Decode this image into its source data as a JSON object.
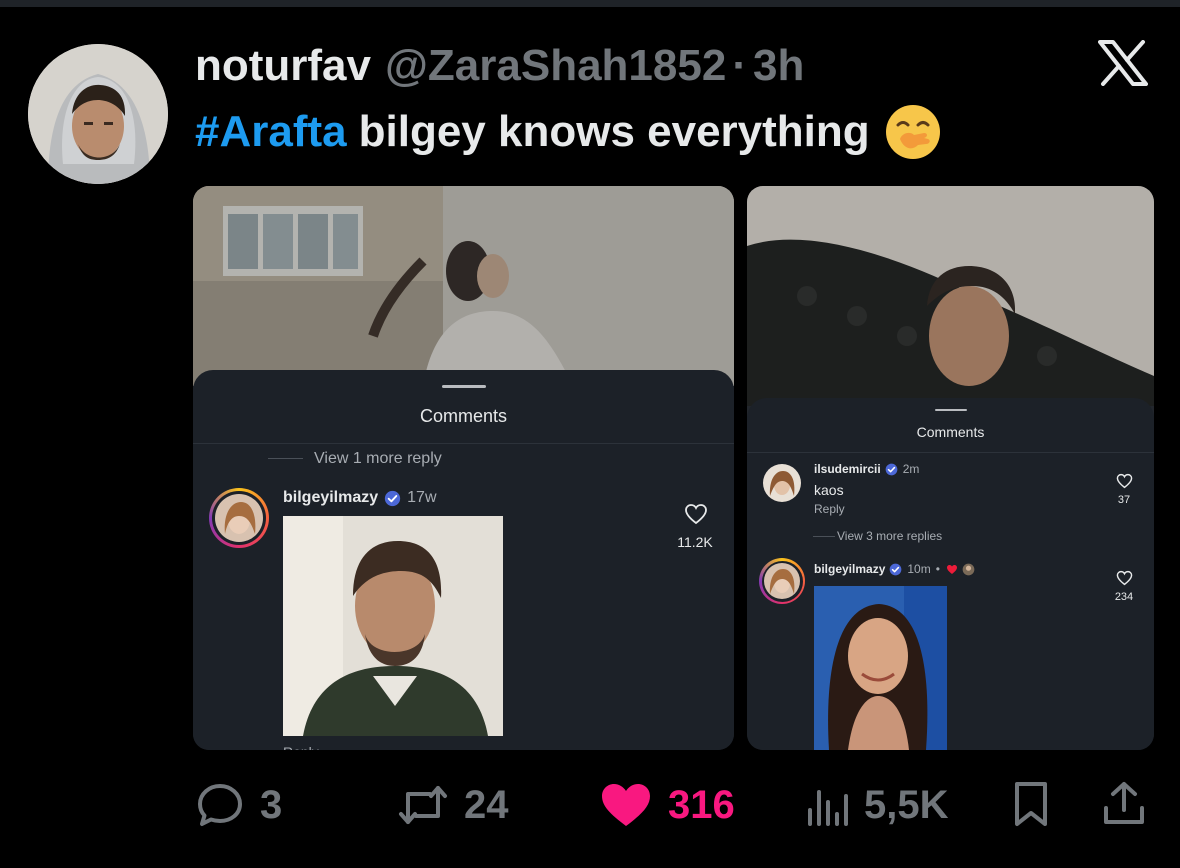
{
  "tweet": {
    "display_name": "noturfav",
    "handle": "@ZaraShah1852",
    "separator": "·",
    "time": "3h",
    "hashtag": "#Arafta",
    "text": "bilgey knows everything",
    "emoji_icon": "face-with-hand-over-mouth-emoji"
  },
  "card1": {
    "sheet_title": "Comments",
    "view_more": "View 1 more reply",
    "comment": {
      "username": "bilgeyilmazy",
      "time": "17w",
      "likes": "11.2K",
      "reply_label": "Reply"
    }
  },
  "card2": {
    "sheet_title": "Comments",
    "comment1": {
      "username": "ilsudemircii",
      "time": "2m",
      "text": "kaos",
      "reply_label": "Reply",
      "likes": "37"
    },
    "view_more": "View 3 more replies",
    "comment2": {
      "username": "bilgeyilmazy",
      "time": "10m",
      "separator": "•",
      "likes": "234"
    }
  },
  "actions": {
    "replies": "3",
    "retweets": "24",
    "likes": "316",
    "views": "5,5K"
  },
  "colors": {
    "background": "#000000",
    "hashtag": "#1d9bf0",
    "like_active": "#f91880",
    "muted": "#71767b",
    "verified": "#4c68d7"
  }
}
